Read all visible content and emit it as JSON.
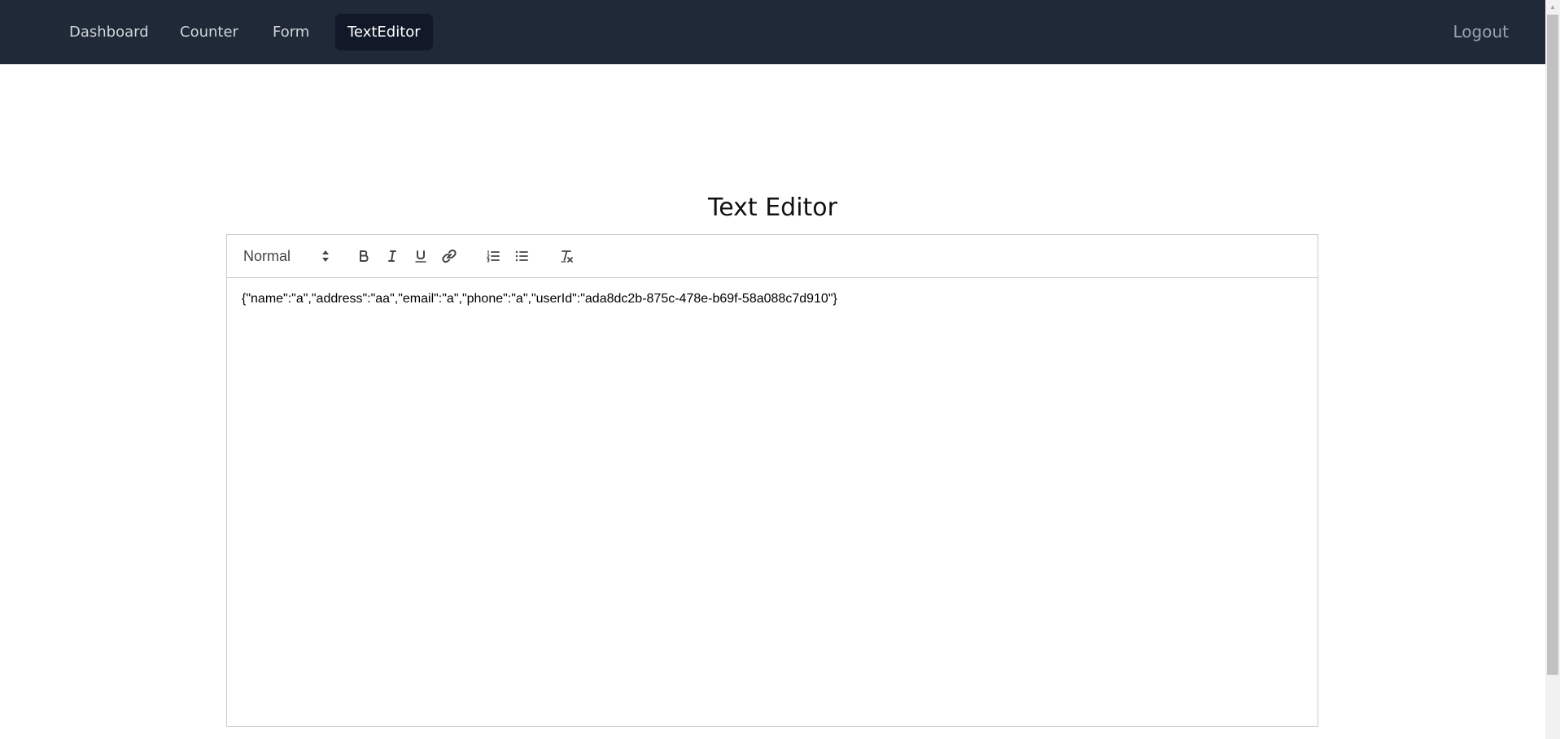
{
  "nav": {
    "items": [
      {
        "label": "Dashboard"
      },
      {
        "label": "Counter"
      },
      {
        "label": "Form"
      },
      {
        "label": "TextEditor"
      }
    ],
    "active": "TextEditor",
    "logout_label": "Logout"
  },
  "page": {
    "title": "Text Editor"
  },
  "editor": {
    "toolbar": {
      "header_select_value": "Normal",
      "buttons": [
        "bold-icon",
        "italic-icon",
        "underline-icon",
        "link-icon",
        "ordered-list-icon",
        "bullet-list-icon",
        "clear-format-icon"
      ]
    },
    "content": "{\"name\":\"a\",\"address\":\"aa\",\"email\":\"a\",\"phone\":\"a\",\"userId\":\"ada8dc2b-875c-478e-b69f-58a088c7d910\"}"
  },
  "colors": {
    "navbar_bg": "#1f2937",
    "nav_active_bg": "#111827",
    "nav_text": "#d1d5db",
    "logout_text": "#9ca3af",
    "editor_border": "#cccccc",
    "icon_stroke": "#444444"
  }
}
